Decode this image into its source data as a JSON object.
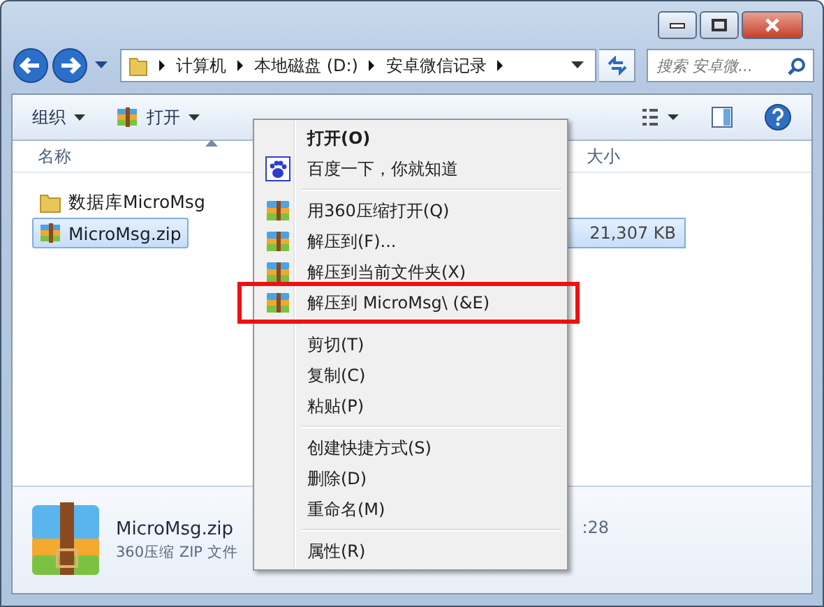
{
  "address_bar": {
    "path": [
      "计算机",
      "本地磁盘 (D:)",
      "安卓微信记录"
    ]
  },
  "search": {
    "placeholder": "搜索 安卓微..."
  },
  "toolbar": {
    "items": [
      "组织",
      "打开"
    ]
  },
  "columns": [
    "名称",
    "大小"
  ],
  "files": [
    {
      "name": "数据库MicroMsg",
      "kind": "folder",
      "selected": false
    },
    {
      "name": "MicroMsg.zip",
      "kind": "archive",
      "size": "21,307 KB",
      "selected": true
    }
  ],
  "details": {
    "name": "MicroMsg.zip",
    "type_label": "360压缩 ZIP 文件",
    "modified": ":28"
  },
  "context_menu": {
    "items": [
      {
        "kind": "plain",
        "label": "打开(O)",
        "bold": true,
        "highlighted": false
      },
      {
        "kind": "search",
        "label": "百度一下，你就知道",
        "bold": false,
        "highlighted": false
      },
      {
        "kind": "separator"
      },
      {
        "kind": "archive",
        "label": "用360压缩打开(Q)",
        "bold": false,
        "highlighted": false
      },
      {
        "kind": "archive",
        "label": "解压到(F)...",
        "bold": false,
        "highlighted": false
      },
      {
        "kind": "archive",
        "label": "解压到当前文件夹(X)",
        "bold": false,
        "highlighted": false
      },
      {
        "kind": "archive",
        "label": "解压到 MicroMsg\\ (&E)",
        "bold": false,
        "highlighted": true
      },
      {
        "kind": "separator"
      },
      {
        "kind": "plain",
        "label": "剪切(T)",
        "bold": false,
        "highlighted": false
      },
      {
        "kind": "plain",
        "label": "复制(C)",
        "bold": false,
        "highlighted": false
      },
      {
        "kind": "plain",
        "label": "粘贴(P)",
        "bold": false,
        "highlighted": false
      },
      {
        "kind": "separator"
      },
      {
        "kind": "plain",
        "label": "创建快捷方式(S)",
        "bold": false,
        "highlighted": false
      },
      {
        "kind": "plain",
        "label": "删除(D)",
        "bold": false,
        "highlighted": false
      },
      {
        "kind": "plain",
        "label": "重命名(M)",
        "bold": false,
        "highlighted": false
      },
      {
        "kind": "separator"
      },
      {
        "kind": "plain",
        "label": "属性(R)",
        "bold": false,
        "highlighted": false
      }
    ]
  }
}
